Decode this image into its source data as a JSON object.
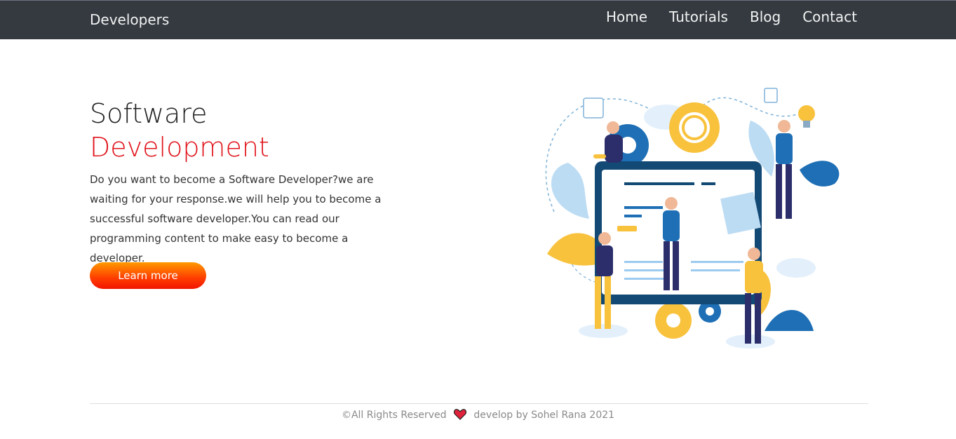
{
  "navbar": {
    "brand": "Developers",
    "links": [
      "Home",
      "Tutorials",
      "Blog",
      "Contact"
    ]
  },
  "hero": {
    "title_line1": "Software",
    "title_line2": "Development",
    "description": "Do you want to become a Software Developer?we are waiting for your response.we will help you to become a successful software developer.You can read our programming content to make easy to become a developer.",
    "button_label": "Learn more"
  },
  "footer": {
    "copyright": "©All Rights Reserved",
    "credit": "develop by Sohel Rana 2021"
  },
  "colors": {
    "navbar_bg": "#343a40",
    "accent_red": "#e0121a",
    "button_gradient_top": "#ff9a00",
    "button_gradient_bottom": "#f21400"
  },
  "icons": {
    "heart": "heart-icon"
  }
}
